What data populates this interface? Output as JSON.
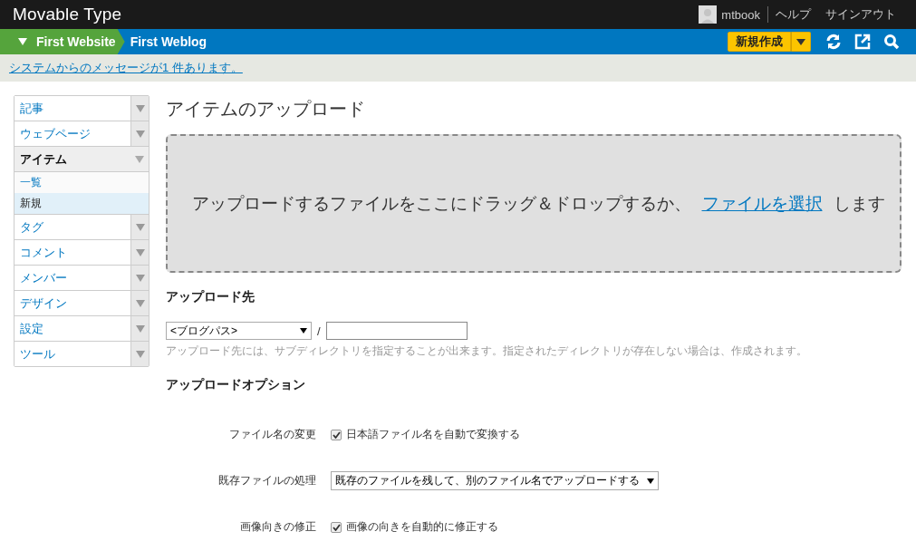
{
  "header": {
    "logo": "Movable Type",
    "user": "mtbook",
    "links": [
      "ヘルプ",
      "サインアウト"
    ]
  },
  "nav": {
    "website": "First Website",
    "weblog": "First Weblog",
    "new_button": "新規作成"
  },
  "message": "システムからのメッセージが1 件あります。",
  "sidebar": {
    "items": [
      {
        "label": "記事",
        "expanded": false
      },
      {
        "label": "ウェブページ",
        "expanded": false
      },
      {
        "label": "アイテム",
        "expanded": true,
        "children": [
          {
            "label": "一覧",
            "selected": false
          },
          {
            "label": "新規",
            "selected": true
          }
        ]
      },
      {
        "label": "タグ",
        "expanded": false
      },
      {
        "label": "コメント",
        "expanded": false
      },
      {
        "label": "メンバー",
        "expanded": false
      },
      {
        "label": "デザイン",
        "expanded": false
      },
      {
        "label": "設定",
        "expanded": false
      },
      {
        "label": "ツール",
        "expanded": false
      }
    ]
  },
  "page_title": "アイテムのアップロード",
  "dropzone": {
    "text": "アップロードするファイルをここにドラッグ＆ドロップするか、",
    "link": "ファイルを選択",
    "suffix": "します"
  },
  "destination": {
    "heading": "アップロード先",
    "select": "<ブログパス>",
    "separator": "/",
    "hint": "アップロード先には、サブディレクトリを指定することが出来ます。指定されたディレクトリが存在しない場合は、作成されます。"
  },
  "options": {
    "heading": "アップロードオプション",
    "rows": [
      {
        "kind": "checkbox",
        "label": "ファイル名の変更",
        "text": "日本語ファイル名を自動で変換する",
        "checked": true
      },
      {
        "kind": "select",
        "label": "既存ファイルの処理",
        "text": "既存のファイルを残して、別のファイル名でアップロードする"
      },
      {
        "kind": "checkbox",
        "label": "画像向きの修正",
        "text": "画像の向きを自動的に修正する",
        "checked": true
      }
    ]
  }
}
